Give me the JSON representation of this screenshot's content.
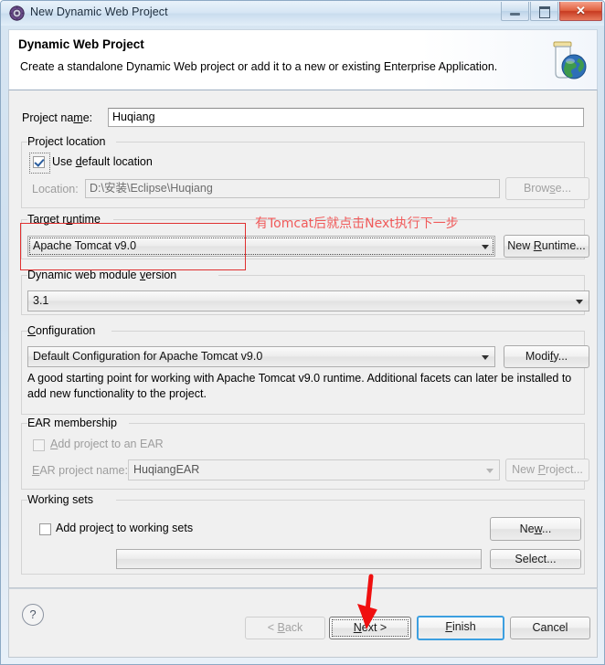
{
  "window": {
    "title": "New Dynamic Web Project",
    "icon": "eclipse-wizard-icon",
    "minimize_label": "",
    "maximize_label": "",
    "close_label": "✕"
  },
  "header": {
    "title": "Dynamic Web Project",
    "description": "Create a standalone Dynamic Web project or add it to a new or existing Enterprise Application.",
    "icon": "web-project-jar-globe-icon"
  },
  "form": {
    "project_name_label": "Project na",
    "project_name_label_mnemonic": "m",
    "project_name_label_tail": "e:",
    "project_name_value": "Huqiang",
    "project_location_group": "Project location",
    "use_default_location_pre": "Use ",
    "use_default_location_mnemonic": "d",
    "use_default_location_post": "efault location",
    "use_default_location_checked": "true",
    "location_label": "Location:",
    "location_value": "D:\\安装\\Eclipse\\Huqiang",
    "browse_label": "Brow",
    "browse_mnemonic": "s",
    "browse_tail": "e...",
    "target_runtime_group_pre": "Target r",
    "target_runtime_group_mnemonic": "u",
    "target_runtime_group_post": "ntime",
    "target_runtime_value": "Apache Tomcat v9.0",
    "new_runtime_pre": "New ",
    "new_runtime_mnemonic": "R",
    "new_runtime_post": "untime...",
    "module_version_group_pre": "Dynamic web module ",
    "module_version_group_mnemonic": "v",
    "module_version_group_post": "ersion",
    "module_version_value": "3.1",
    "configuration_group_mnemonic": "C",
    "configuration_group_post": "onfiguration",
    "configuration_value": "Default Configuration for Apache Tomcat v9.0",
    "modify_pre": "Modi",
    "modify_mnemonic": "f",
    "modify_post": "y...",
    "configuration_description": "A good starting point for working with Apache Tomcat v9.0 runtime. Additional facets can later be installed to add new functionality to the project.",
    "ear_membership_group": "EAR membership",
    "add_project_to_ear_pre": "",
    "add_project_to_ear_mnemonic": "A",
    "add_project_to_ear_post": "dd project to an EAR",
    "add_project_to_ear_checked": "false",
    "ear_project_name_label_mnemonic": "E",
    "ear_project_name_label_post": "AR project name:",
    "ear_project_name_value": "HuqiangEAR",
    "new_project_pre": "New ",
    "new_project_mnemonic": "P",
    "new_project_post": "roject...",
    "working_sets_group": "Working sets",
    "add_to_working_sets_pre": "Add projec",
    "add_to_working_sets_mnemonic": "t",
    "add_to_working_sets_post": " to working sets",
    "add_to_working_sets_checked": "false",
    "new_working_set_pre": "Ne",
    "new_working_set_mnemonic": "w",
    "new_working_set_post": "...",
    "working_sets_field_value": "",
    "select_label": "Select..."
  },
  "buttons": {
    "back_pre": "< ",
    "back_mnemonic": "B",
    "back_post": "ack",
    "next_mnemonic": "N",
    "next_post": "ext >",
    "finish_pre": "",
    "finish_mnemonic": "F",
    "finish_post": "inish",
    "cancel_label": "Cancel",
    "help_label": "?"
  },
  "annotations": {
    "note_text": "有Tomcat后就点击Next执行下一步",
    "note_color": "#f05a5a",
    "highlight_box_color": "#e03030",
    "arrow_color": "#f01010",
    "arrow_target": "next-button"
  }
}
